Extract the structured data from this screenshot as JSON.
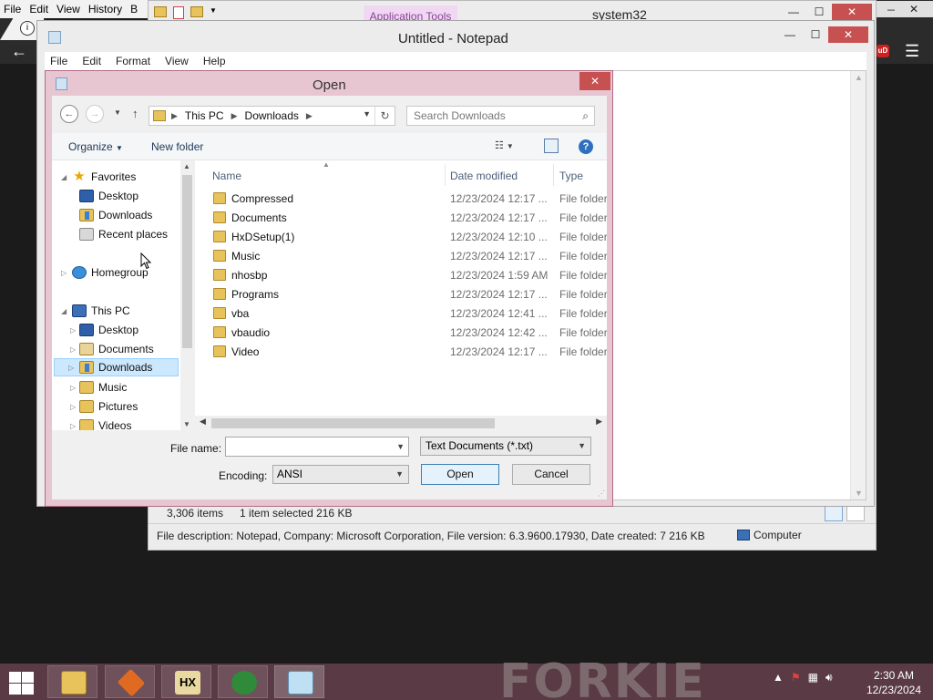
{
  "browser": {
    "menu": [
      "File",
      "Edit",
      "View",
      "History",
      "B"
    ],
    "info_glyph": "i",
    "back_glyph": "←",
    "minimize_glyph": "—",
    "close_glyph": "✕",
    "menu_glyph": "☰",
    "extension_glyph": "uD"
  },
  "explorer": {
    "context_tab": "Application Tools",
    "title": "system32",
    "status_items": "3,306 items",
    "status_selected": "1 item selected  216 KB",
    "details": "File description: Notepad, Company: Microsoft Corporation, File version: 6.3.9600.17930, Date created: 7 216 KB",
    "location": "Computer"
  },
  "notepad": {
    "title": "Untitled - Notepad",
    "menu": [
      "File",
      "Edit",
      "Format",
      "View",
      "Help"
    ]
  },
  "dialog": {
    "title": "Open",
    "breadcrumb": [
      "This PC",
      "Downloads"
    ],
    "search_placeholder": "Search Downloads",
    "toolbar": {
      "organize": "Organize",
      "new_folder": "New folder"
    },
    "nav": [
      {
        "label": "Favorites",
        "icon": "star-icon",
        "level": 0,
        "expanded": true
      },
      {
        "label": "Desktop",
        "icon": "desktop-icon",
        "level": 1
      },
      {
        "label": "Downloads",
        "icon": "downloads-icon",
        "level": 1
      },
      {
        "label": "Recent places",
        "icon": "recent-places-icon",
        "level": 1
      },
      {
        "label": "Homegroup",
        "icon": "homegroup-icon",
        "level": 0,
        "expanded": false
      },
      {
        "label": "This PC",
        "icon": "computer-icon",
        "level": 0,
        "expanded": true
      },
      {
        "label": "Desktop",
        "icon": "desktop-icon",
        "level": 1
      },
      {
        "label": "Documents",
        "icon": "documents-icon",
        "level": 1
      },
      {
        "label": "Downloads",
        "icon": "downloads-icon",
        "level": 1,
        "selected": true
      },
      {
        "label": "Music",
        "icon": "music-icon",
        "level": 1
      },
      {
        "label": "Pictures",
        "icon": "pictures-icon",
        "level": 1
      },
      {
        "label": "Videos",
        "icon": "videos-icon",
        "level": 1
      }
    ],
    "columns": [
      "Name",
      "Date modified",
      "Type"
    ],
    "files": [
      {
        "name": "Compressed",
        "date": "12/23/2024 12:17 ...",
        "type": "File folder"
      },
      {
        "name": "Documents",
        "date": "12/23/2024 12:17 ...",
        "type": "File folder"
      },
      {
        "name": "HxDSetup(1)",
        "date": "12/23/2024 12:10 ...",
        "type": "File folder"
      },
      {
        "name": "Music",
        "date": "12/23/2024 12:17 ...",
        "type": "File folder"
      },
      {
        "name": "nhosbp",
        "date": "12/23/2024 1:59 AM",
        "type": "File folder"
      },
      {
        "name": "Programs",
        "date": "12/23/2024 12:17 ...",
        "type": "File folder"
      },
      {
        "name": "vba",
        "date": "12/23/2024 12:41 ...",
        "type": "File folder"
      },
      {
        "name": "vbaudio",
        "date": "12/23/2024 12:42 ...",
        "type": "File folder"
      },
      {
        "name": "Video",
        "date": "12/23/2024 12:17 ...",
        "type": "File folder"
      }
    ],
    "file_name_label": "File name:",
    "file_name_value": "",
    "file_type": "Text Documents (*.txt)",
    "encoding_label": "Encoding:",
    "encoding": "ANSI",
    "open_label": "Open",
    "cancel_label": "Cancel"
  },
  "taskbar": {
    "watermark": "FORKIE",
    "time": "2:30 AM",
    "date": "12/23/2024",
    "apps": [
      "file-explorer-icon",
      "app-orange-icon",
      "hxd-icon",
      "internet-download-manager-icon",
      "notepad-icon"
    ]
  }
}
